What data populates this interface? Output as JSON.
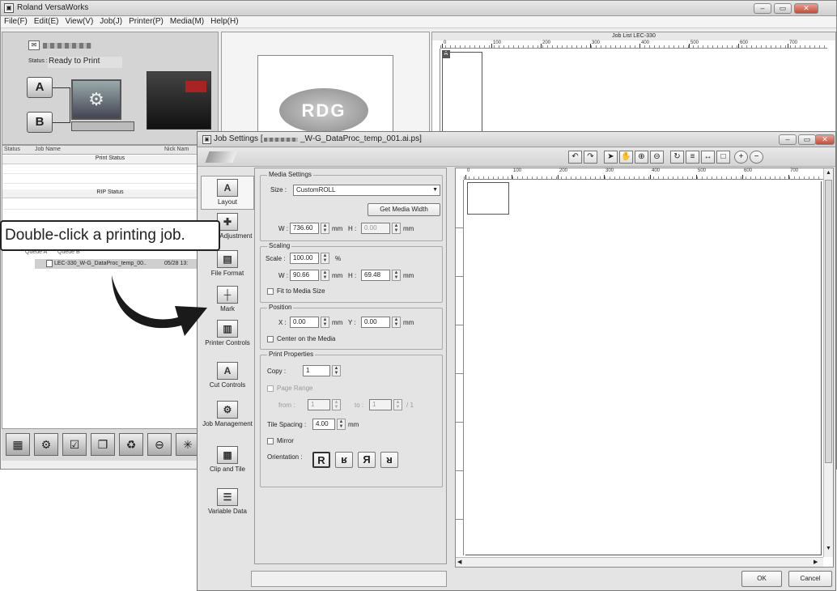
{
  "main_window": {
    "title": "Roland VersaWorks",
    "menu": [
      "File(F)",
      "Edit(E)",
      "View(V)",
      "Job(J)",
      "Printer(P)",
      "Media(M)",
      "Help(H)"
    ],
    "printer_status_label": "Status :",
    "printer_status_value": "Ready to Print",
    "queue_a_letter": "A",
    "queue_b_letter": "B",
    "job_columns": [
      "Status",
      "Job Name",
      "Nick Nam"
    ],
    "print_status_header": "Print Status",
    "rip_status_header": "RIP Status",
    "queue_tabs": [
      "Queue A",
      "Queue B"
    ],
    "job_row": {
      "name": "LEC-330_W-G_DataProc_temp_00..",
      "date": "05/28 13:"
    },
    "preview_logo": "RDG",
    "job_list_title": "Job List LEC-330",
    "job_list_marker": "A",
    "top_ruler_ticks": [
      "0",
      "100",
      "200",
      "300",
      "400",
      "500",
      "600",
      "700"
    ]
  },
  "callout": {
    "text": "Double-click a printing job."
  },
  "dialog": {
    "title_prefix": "Job Settings [",
    "title_suffix": "_W-G_DataProc_temp_001.ai.ps]",
    "sidebar": [
      {
        "id": "layout",
        "label": "Layout",
        "icon": "layout-icon",
        "glyph": "A"
      },
      {
        "id": "color",
        "label": "Color Adjustment",
        "icon": "color-adjustment-icon",
        "glyph": "✚"
      },
      {
        "id": "fileformat",
        "label": "File Format",
        "icon": "file-format-icon",
        "glyph": "▤"
      },
      {
        "id": "mark",
        "label": "Mark",
        "icon": "mark-icon",
        "glyph": "┼"
      },
      {
        "id": "printer",
        "label": "Printer Controls",
        "icon": "printer-controls-icon",
        "glyph": "▥"
      },
      {
        "id": "cut",
        "label": "Cut Controls",
        "icon": "cut-controls-icon",
        "glyph": "A"
      },
      {
        "id": "job",
        "label": "Job Management",
        "icon": "job-management-icon",
        "glyph": "⚙"
      },
      {
        "id": "clip",
        "label": "Clip and Tile",
        "icon": "clip-and-tile-icon",
        "glyph": "▦"
      },
      {
        "id": "variable",
        "label": "Variable Data",
        "icon": "variable-data-icon",
        "glyph": "☰"
      }
    ],
    "media": {
      "legend": "Media Settings",
      "size_label": "Size :",
      "size_value": "CustomROLL",
      "get_width_button": "Get Media Width",
      "w_label": "W :",
      "w_value": "736.60",
      "w_unit": "mm",
      "h_label": "H :",
      "h_value": "0.00",
      "h_unit": "mm"
    },
    "scaling": {
      "legend": "Scaling",
      "scale_label": "Scale :",
      "scale_value": "100.00",
      "scale_unit": "%",
      "w_label": "W :",
      "w_value": "90.66",
      "w_unit": "mm",
      "h_label": "H :",
      "h_value": "69.48",
      "h_unit": "mm",
      "fit_label": "Fit to Media Size"
    },
    "position": {
      "legend": "Position",
      "x_label": "X :",
      "x_value": "0.00",
      "x_unit": "mm",
      "y_label": "Y :",
      "y_value": "0.00",
      "y_unit": "mm",
      "center_label": "Center on the Media"
    },
    "print_props": {
      "legend": "Print Properties",
      "copy_label": "Copy :",
      "copy_value": "1",
      "page_range_label": "Page Range",
      "from_label": "from :",
      "from_value": "1",
      "to_label": "to :",
      "to_value": "1",
      "total": "/ 1",
      "tile_label": "Tile Spacing :",
      "tile_value": "4.00",
      "tile_unit": "mm",
      "mirror_label": "Mirror",
      "orientation_label": "Orientation :",
      "orientation_glyphs": [
        "R",
        "ʁ",
        "Я",
        "ᴚ"
      ]
    },
    "ruler_ticks": [
      "0",
      "100",
      "200",
      "300",
      "400",
      "500",
      "600",
      "700"
    ],
    "ok_button": "OK",
    "cancel_button": "Cancel"
  }
}
